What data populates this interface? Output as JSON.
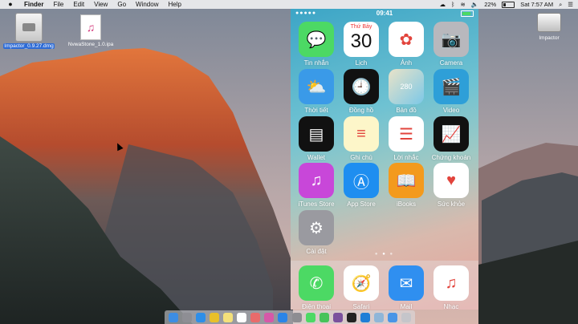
{
  "menubar": {
    "apple": "",
    "items": [
      "Finder",
      "File",
      "Edit",
      "View",
      "Go",
      "Window",
      "Help"
    ],
    "battery": "22%",
    "clock": "Sat 7:57 AM"
  },
  "desktop": {
    "icons": [
      {
        "label": "Impactor_0.9.27.dmg",
        "icon": "dmg-file-icon"
      },
      {
        "label": "NvwaStone_1.0.ipa",
        "icon": "ipa-file-icon"
      },
      {
        "label": "Impactor",
        "icon": "disk-icon"
      }
    ],
    "ipa_glyph": "♫"
  },
  "phone": {
    "time": "09:41",
    "dots": "●●●●●",
    "calendar": {
      "day": "Thứ Bảy",
      "date": "30"
    },
    "apps": [
      {
        "label": "Tin nhắn",
        "icon": "messages-icon",
        "color": "#4cd964",
        "glyph": "💬"
      },
      {
        "label": "Lịch",
        "icon": "calendar-icon",
        "color": "#ffffff",
        "glyph": ""
      },
      {
        "label": "Ảnh",
        "icon": "photos-icon",
        "color": "#ffffff",
        "glyph": "✿"
      },
      {
        "label": "Camera",
        "icon": "camera-icon",
        "color": "#b8b8bd",
        "glyph": "📷"
      },
      {
        "label": "Thời tiết",
        "icon": "weather-icon",
        "color": "#3a9ae8",
        "glyph": "⛅"
      },
      {
        "label": "Đồng hồ",
        "icon": "clock-icon",
        "color": "#111111",
        "glyph": "🕘"
      },
      {
        "label": "Bản đồ",
        "icon": "maps-icon",
        "color": "#e9e3c8",
        "glyph": "280"
      },
      {
        "label": "Video",
        "icon": "videos-icon",
        "color": "#2e9fd8",
        "glyph": "🎬"
      },
      {
        "label": "Wallet",
        "icon": "wallet-icon",
        "color": "#111111",
        "glyph": "▤"
      },
      {
        "label": "Ghi chú",
        "icon": "notes-icon",
        "color": "#fdf6c9",
        "glyph": "≡"
      },
      {
        "label": "Lời nhắc",
        "icon": "reminders-icon",
        "color": "#ffffff",
        "glyph": "☰"
      },
      {
        "label": "Chứng khoán",
        "icon": "stocks-icon",
        "color": "#111111",
        "glyph": "📈"
      },
      {
        "label": "iTunes Store",
        "icon": "itunes-store-icon",
        "color": "#c847d9",
        "glyph": "♫"
      },
      {
        "label": "App Store",
        "icon": "app-store-icon",
        "color": "#1e8ef0",
        "glyph": "Ⓐ"
      },
      {
        "label": "iBooks",
        "icon": "ibooks-icon",
        "color": "#f39a1d",
        "glyph": "📖"
      },
      {
        "label": "Sức khỏe",
        "icon": "health-icon",
        "color": "#ffffff",
        "glyph": "♥"
      },
      {
        "label": "Cài đặt",
        "icon": "settings-icon",
        "color": "#9a9aa0",
        "glyph": "⚙"
      }
    ],
    "dock": [
      {
        "label": "Điện thoại",
        "icon": "phone-icon",
        "color": "#4cd964",
        "glyph": "✆"
      },
      {
        "label": "Safari",
        "icon": "safari-icon",
        "color": "#ffffff",
        "glyph": "🧭"
      },
      {
        "label": "Mail",
        "icon": "mail-icon",
        "color": "#2f8ff0",
        "glyph": "✉"
      },
      {
        "label": "Nhạc",
        "icon": "music-icon",
        "color": "#ffffff",
        "glyph": "♫"
      }
    ]
  },
  "macdock": {
    "items": [
      {
        "icon": "finder-icon",
        "color": "#3d8de3"
      },
      {
        "icon": "launchpad-icon",
        "color": "#8e8e94"
      },
      {
        "icon": "safari-dock-icon",
        "color": "#2e8ee8"
      },
      {
        "icon": "chrome-icon",
        "color": "#e8c02a"
      },
      {
        "icon": "notes-dock-icon",
        "color": "#f4e07a"
      },
      {
        "icon": "calendar-dock-icon",
        "color": "#ffffff"
      },
      {
        "icon": "photos-dock-icon",
        "color": "#e86b6b"
      },
      {
        "icon": "itunes-dock-icon",
        "color": "#d658a8"
      },
      {
        "icon": "app-store-dock-icon",
        "color": "#2a84e8"
      },
      {
        "icon": "system-prefs-icon",
        "color": "#8d8d92"
      },
      {
        "icon": "messages-dock-icon",
        "color": "#4cd964"
      },
      {
        "icon": "facetime-icon",
        "color": "#46c35a"
      },
      {
        "icon": "viber-icon",
        "color": "#7b519d"
      },
      {
        "icon": "terminal-icon",
        "color": "#222222"
      },
      {
        "icon": "xcode-icon",
        "color": "#1f7ed6"
      },
      {
        "icon": "preview-icon",
        "color": "#8fb6d8"
      },
      {
        "icon": "downloads-icon",
        "color": "#4a95e6"
      },
      {
        "icon": "trash-icon",
        "color": "#c5c5ca"
      }
    ]
  }
}
